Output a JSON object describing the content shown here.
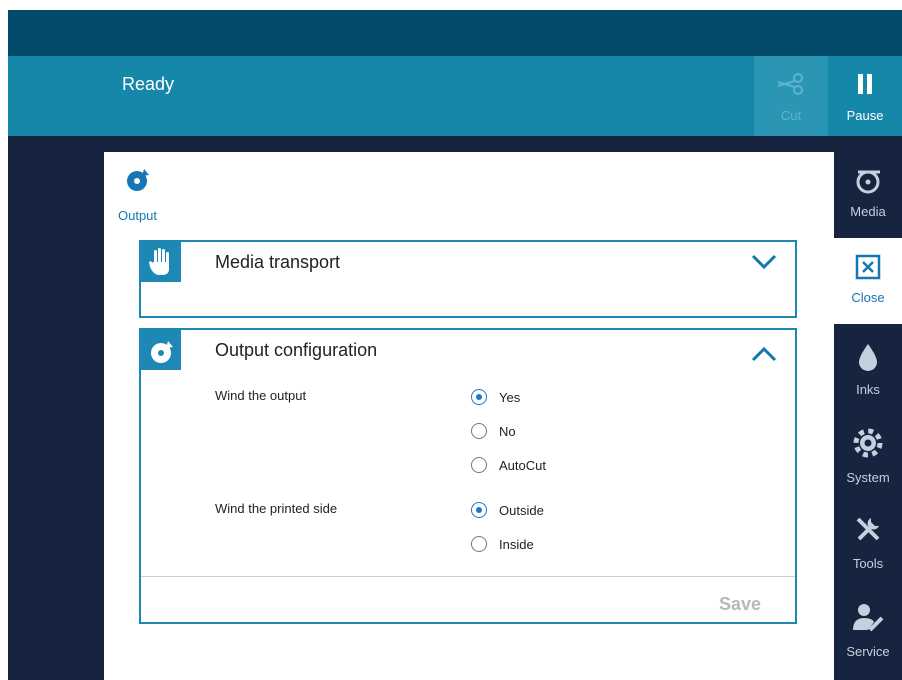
{
  "status": {
    "text": "Ready"
  },
  "toolbar": {
    "cut_label": "Cut",
    "pause_label": "Pause"
  },
  "panel": {
    "label": "Output",
    "icon": "output-icon"
  },
  "sections": {
    "media_transport": {
      "title": "Media transport",
      "icon": "hand-icon",
      "expanded": false
    },
    "output_configuration": {
      "title": "Output configuration",
      "icon": "output-icon",
      "expanded": true,
      "wind_output": {
        "label": "Wind the output",
        "options": [
          "Yes",
          "No",
          "AutoCut"
        ],
        "selected": "Yes"
      },
      "wind_side": {
        "label": "Wind the printed side",
        "options": [
          "Outside",
          "Inside"
        ],
        "selected": "Outside"
      },
      "save_label": "Save"
    }
  },
  "sidebar": {
    "items": [
      {
        "label": "Media",
        "icon": "media-roll-icon"
      },
      {
        "label": "Close",
        "icon": "close-icon",
        "active": true
      },
      {
        "label": "Inks",
        "icon": "ink-drop-icon"
      },
      {
        "label": "System",
        "icon": "gear-icon"
      },
      {
        "label": "Tools",
        "icon": "tools-icon"
      },
      {
        "label": "Service",
        "icon": "service-icon"
      }
    ]
  },
  "colors": {
    "top_strip": "#024b6b",
    "status_bar": "#1587a8",
    "dark_bg": "#16243f",
    "accent": "#1e88b4",
    "radio_selected": "#1e78c8"
  }
}
